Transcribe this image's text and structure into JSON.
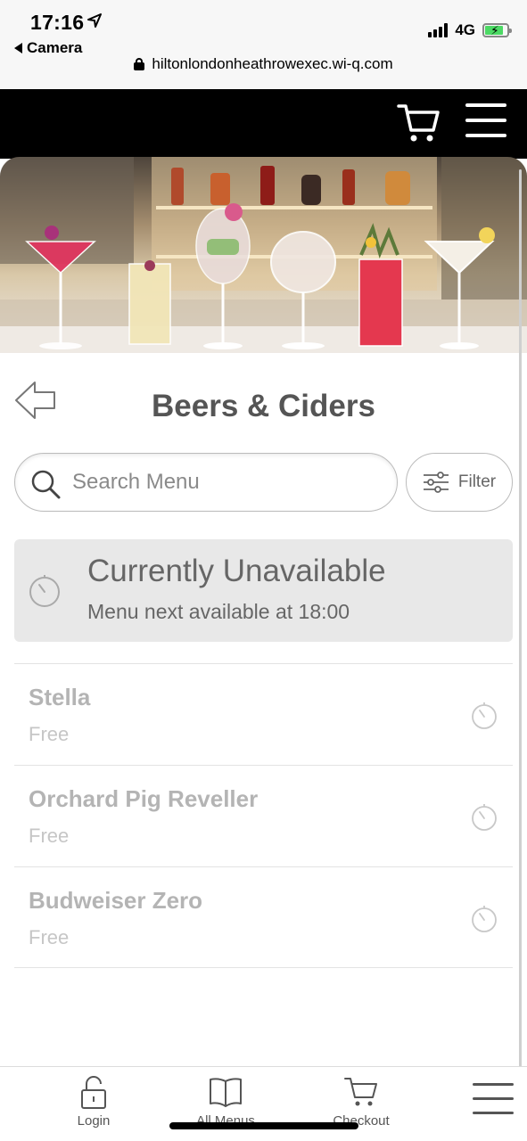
{
  "status_bar": {
    "time": "17:16",
    "back_label": "Camera",
    "network": "4G",
    "url": "hiltonlondonheathrowexec.wi-q.com"
  },
  "header": {
    "cart_icon": "cart-icon",
    "menu_icon": "hamburger-menu-icon"
  },
  "page": {
    "title": "Beers & Ciders"
  },
  "search": {
    "placeholder": "Search Menu",
    "value": ""
  },
  "filter": {
    "label": "Filter"
  },
  "availability": {
    "title": "Currently Unavailable",
    "subtitle": "Menu next available at 18:00"
  },
  "menu_items": [
    {
      "name": "Stella",
      "price": "Free"
    },
    {
      "name": "Orchard Pig Reveller",
      "price": "Free"
    },
    {
      "name": "Budweiser Zero",
      "price": "Free"
    }
  ],
  "bottom_nav": {
    "login_label": "Login",
    "all_menus_label": "All Menus",
    "checkout_label": "Checkout"
  },
  "colors": {
    "header_bg": "#000000",
    "unavailable_bg": "#e8e8e8",
    "muted_text": "#b4b4b4"
  }
}
